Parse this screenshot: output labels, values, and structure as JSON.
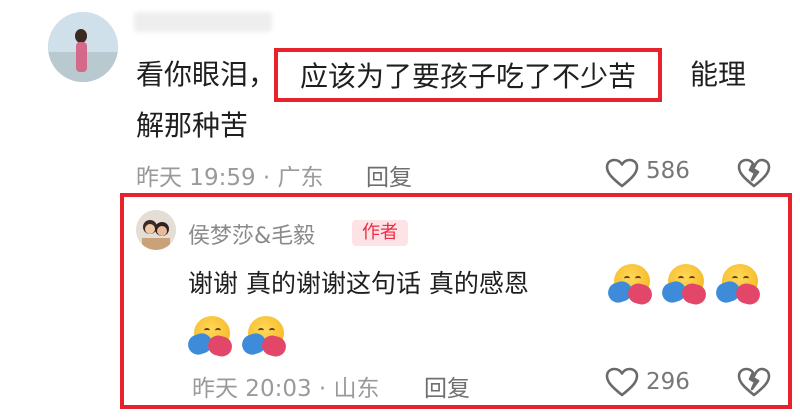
{
  "comment": {
    "line1_start": "看你眼泪，",
    "highlight": "应该为了要孩子吃了不少苦",
    "line1_end": "能理",
    "line2": "解那种苦",
    "time_location": "昨天 19:59 · 广东",
    "reply_label": "回复",
    "likes": "586"
  },
  "reply": {
    "author": "侯梦莎&毛毅",
    "badge": "作者",
    "text": "谢谢 真的谢谢这句话 真的感恩",
    "emoji_count_line1": 3,
    "emoji_count_line2": 2,
    "time_location": "昨天 20:03 · 山东",
    "reply_label": "回复",
    "likes": "296"
  },
  "colors": {
    "highlight_border": "#e8222a",
    "badge_bg": "#fde3e6",
    "badge_text": "#ee2c47",
    "meta_text": "#9a9a9a"
  }
}
